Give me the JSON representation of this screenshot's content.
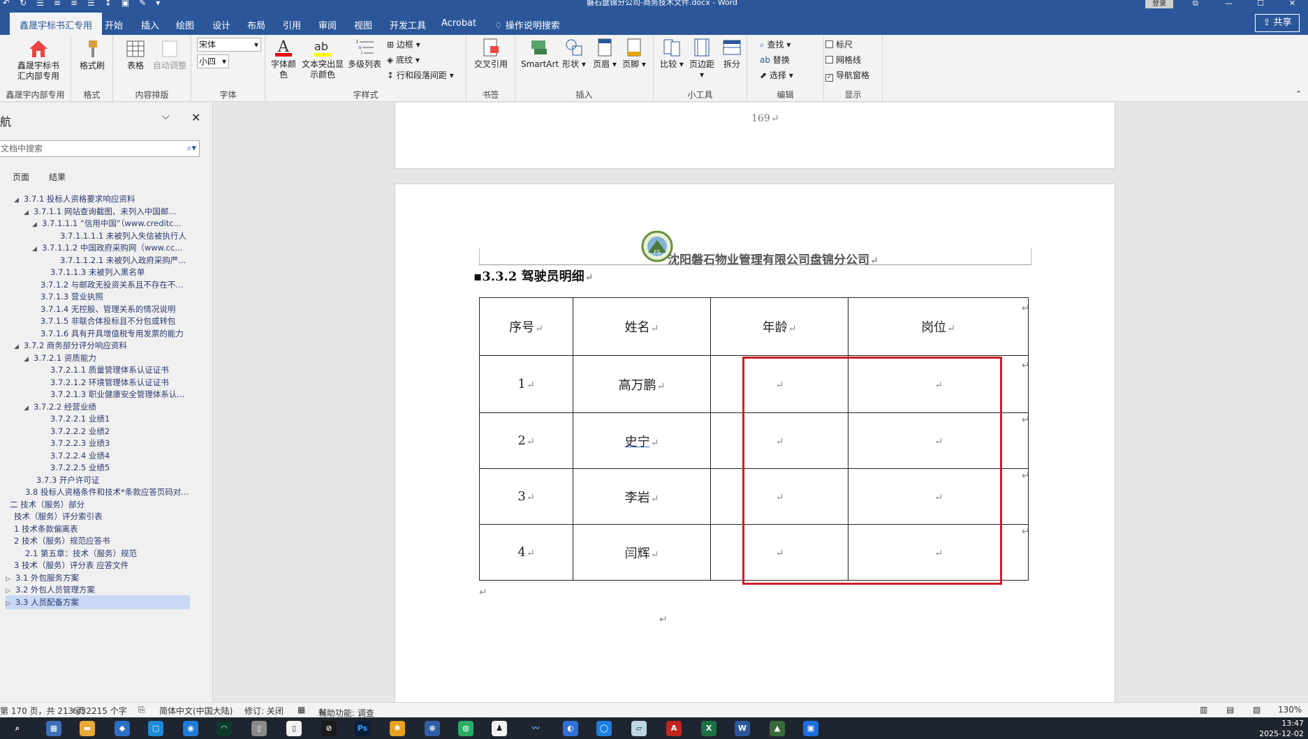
{
  "window": {
    "title": "磐石盘锦分公司-商务技术文件.docx  -  Word",
    "login": "登录"
  },
  "tabs": [
    "鑫晟宇标书汇专用",
    "开始",
    "插入",
    "绘图",
    "设计",
    "布局",
    "引用",
    "审阅",
    "视图",
    "开发工具",
    "Acrobat"
  ],
  "tell_me": "操作说明搜索",
  "share": "共享",
  "ribbon": {
    "g1": {
      "btn": "鑫晟宇标书汇内部专用",
      "label": "鑫晟宇内部专用"
    },
    "g2": {
      "btn": "格式刷",
      "label": "格式"
    },
    "g3": {
      "btn1": "表格",
      "btn2": "自动调整",
      "label": "内容排版"
    },
    "g4": {
      "font_name": "宋体",
      "font_size": "小四",
      "label": "字体"
    },
    "g5": {
      "btn1": "字体颜色",
      "btn2": "文本突出显示颜色",
      "btn3": "多级列表",
      "border": "边框",
      "shading": "底纹",
      "spacing": "行和段落间距",
      "label": "字样式"
    },
    "g6": {
      "btn": "交叉引用",
      "label": "书签"
    },
    "g7": {
      "btn1": "SmartArt",
      "btn2": "形状",
      "btn3": "页眉",
      "btn4": "页脚",
      "label": "插入"
    },
    "g8": {
      "btn1": "比较",
      "btn2": "页边距",
      "btn3": "拆分",
      "label": "小工具"
    },
    "g9": {
      "find": "查找",
      "replace": "替换",
      "select": "选择",
      "label": "编辑"
    },
    "g10": {
      "ruler": "标尺",
      "grid": "网格线",
      "nav": "导航窗格",
      "label": "显示"
    }
  },
  "nav": {
    "title": "导航",
    "search_placeholder": "在文档中搜索",
    "tab_pages": "页面",
    "tab_results": "结果",
    "items": [
      {
        "text": "3.7.1 投标人资格要求响应资料",
        "indent": 20,
        "tri": "◢"
      },
      {
        "text": "3.7.1.1 网站查询截图、未列入中国邮...",
        "indent": 34,
        "tri": "◢"
      },
      {
        "text": "3.7.1.1.1 “信用中国”（www.creditc...",
        "indent": 46,
        "tri": "◢"
      },
      {
        "text": "3.7.1.1.1.1 未被列入失信被执行人",
        "indent": 72,
        "tri": ""
      },
      {
        "text": "3.7.1.1.2 中国政府采购网（www.cc...",
        "indent": 46,
        "tri": "◢"
      },
      {
        "text": "3.7.1.1.2.1 未被列入政府采购严...",
        "indent": 72,
        "tri": ""
      },
      {
        "text": "3.7.1.1.3 未被列入黑名单",
        "indent": 58,
        "tri": ""
      },
      {
        "text": "3.7.1.2 与邮政无投资关系且不存在不...",
        "indent": 44,
        "tri": ""
      },
      {
        "text": "3.7.1.3 营业执照",
        "indent": 44,
        "tri": ""
      },
      {
        "text": "3.7.1.4 无控股、管理关系的情况说明",
        "indent": 44,
        "tri": ""
      },
      {
        "text": "3.7.1.5 非联合体投标且不分包或转包",
        "indent": 44,
        "tri": ""
      },
      {
        "text": "3.7.1.6 具有开具增值税专用发票的能力",
        "indent": 44,
        "tri": ""
      },
      {
        "text": "3.7.2 商务部分评分响应资料",
        "indent": 20,
        "tri": "◢"
      },
      {
        "text": "3.7.2.1 资质能力",
        "indent": 34,
        "tri": "◢"
      },
      {
        "text": "3.7.2.1.1 质量管理体系认证证书",
        "indent": 58,
        "tri": ""
      },
      {
        "text": "3.7.2.1.2 环境管理体系认证证书",
        "indent": 58,
        "tri": ""
      },
      {
        "text": "3.7.2.1.3 职业健康安全管理体系认...",
        "indent": 58,
        "tri": ""
      },
      {
        "text": "3.7.2.2 经营业绩",
        "indent": 34,
        "tri": "◢"
      },
      {
        "text": "3.7.2.2.1 业绩1",
        "indent": 58,
        "tri": ""
      },
      {
        "text": "3.7.2.2.2 业绩2",
        "indent": 58,
        "tri": ""
      },
      {
        "text": "3.7.2.2.3 业绩3",
        "indent": 58,
        "tri": ""
      },
      {
        "text": "3.7.2.2.4 业绩4",
        "indent": 58,
        "tri": ""
      },
      {
        "text": "3.7.2.2.5 业绩5",
        "indent": 58,
        "tri": ""
      },
      {
        "text": "3.7.3 开户许可证",
        "indent": 38,
        "tri": ""
      },
      {
        "text": "3.8 投标人资格条件和技术*条款应答页码对...",
        "indent": 22,
        "tri": ""
      },
      {
        "text": "二 技术（服务）部分",
        "indent": 0,
        "tri": ""
      },
      {
        "text": "技术（服务）评分索引表",
        "indent": 6,
        "tri": ""
      },
      {
        "text": "1 技术条款偏离表",
        "indent": 6,
        "tri": ""
      },
      {
        "text": "2 技术（服务）规范应答书",
        "indent": 6,
        "tri": ""
      },
      {
        "text": "2.1 第五章：技术（服务）规范",
        "indent": 22,
        "tri": ""
      },
      {
        "text": "3 技术（服务）评分表 应答文件",
        "indent": 6,
        "tri": ""
      },
      {
        "text": "3.1 外包服务方案",
        "indent": 8,
        "tri": "▷"
      },
      {
        "text": "3.2 外包人员管理方案",
        "indent": 8,
        "tri": "▷"
      },
      {
        "text": "3.3 人员配备方案",
        "indent": 8,
        "tri": "▷",
        "selected": true
      }
    ]
  },
  "doc": {
    "page_number": "169",
    "company_header": "沈阳磐石物业管理有限公司盘锦分公司",
    "heading": "3.3.2 驾驶员明细",
    "table": {
      "headers": [
        "序号",
        "姓名",
        "年龄",
        "岗位"
      ],
      "rows": [
        [
          "1",
          "高万鹏",
          "",
          ""
        ],
        [
          "2",
          "史宁",
          "",
          ""
        ],
        [
          "3",
          "李岩",
          "",
          ""
        ],
        [
          "4",
          "闫辉",
          "",
          ""
        ]
      ]
    }
  },
  "status": {
    "page": "第 170 页，共 213 页",
    "words": "6/32215 个字",
    "lang": "简体中文(中国大陆)",
    "track": "修订: 关闭",
    "access": "辅助功能: 调查",
    "zoom": "130%"
  },
  "taskbar": {
    "time": "13:47",
    "date": "2025-12-02"
  },
  "colors": {
    "word_blue": "#2b579a",
    "highlight_box": "#cc1f2a"
  }
}
